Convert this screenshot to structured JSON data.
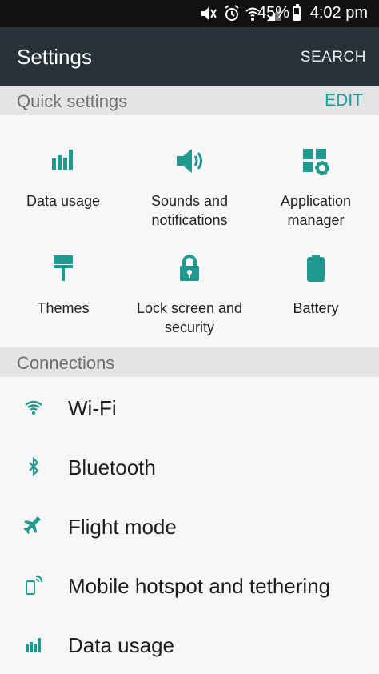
{
  "status_bar": {
    "battery_percent_text": "45%",
    "battery_level": 0.45,
    "time": "4:02 pm",
    "icons": [
      "mute-icon",
      "alarm-icon",
      "wifi-icon",
      "signal-icon",
      "battery-icon"
    ]
  },
  "app_bar": {
    "title": "Settings",
    "search_label": "SEARCH"
  },
  "quick_settings": {
    "header": "Quick settings",
    "edit_label": "EDIT",
    "items": [
      {
        "label_line1": "Data usage",
        "label_line2": "",
        "icon": "data-usage-icon"
      },
      {
        "label_line1": "Sounds and",
        "label_line2": "notifications",
        "icon": "speaker-icon"
      },
      {
        "label_line1": "Application",
        "label_line2": "manager",
        "icon": "app-manager-icon"
      },
      {
        "label_line1": "Themes",
        "label_line2": "",
        "icon": "paint-roller-icon"
      },
      {
        "label_line1": "Lock screen and",
        "label_line2": "security",
        "icon": "lock-icon"
      },
      {
        "label_line1": "Battery",
        "label_line2": "",
        "icon": "battery-icon"
      }
    ]
  },
  "connections": {
    "header": "Connections",
    "items": [
      {
        "label": "Wi-Fi",
        "icon": "wifi-icon"
      },
      {
        "label": "Bluetooth",
        "icon": "bluetooth-icon"
      },
      {
        "label": "Flight mode",
        "icon": "airplane-icon"
      },
      {
        "label": "Mobile hotspot and tethering",
        "icon": "hotspot-icon"
      },
      {
        "label": "Data usage",
        "icon": "data-usage-icon"
      }
    ]
  },
  "colors": {
    "accent": "#1a9fa9",
    "icon_teal": "#1f9a8f",
    "app_bar": "#263238",
    "status_bar": "#111111",
    "section_header": "#e4e4e4"
  }
}
